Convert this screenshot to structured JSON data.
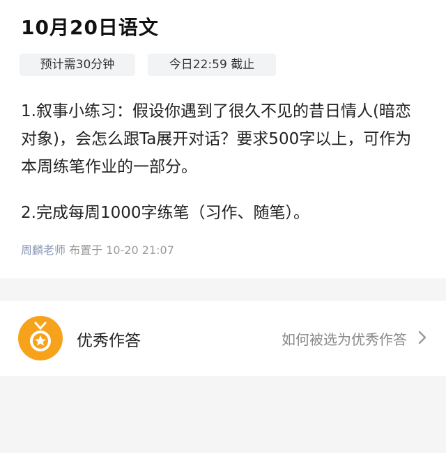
{
  "header": {
    "title": "10月20日语文"
  },
  "tags": {
    "estimate": "预计需30分钟",
    "deadline": "今日22:59 截止"
  },
  "assignment": {
    "item1": "1.叙事小练习：假设你遇到了很久不见的昔日情人(暗恋对象)，会怎么跟Ta展开对话？要求500字以上，可作为本周练笔作业的一部分。",
    "item2": "2.完成每周1000字练笔（习作、随笔）。"
  },
  "meta": {
    "teacher": "周麟老师",
    "posted": "布置于 10-20 21:07"
  },
  "excellent": {
    "label": "优秀作答",
    "link": "如何被选为优秀作答",
    "icon": "medal-icon",
    "chevron_icon": "chevron-right-icon",
    "accent": "#f7a21b"
  }
}
